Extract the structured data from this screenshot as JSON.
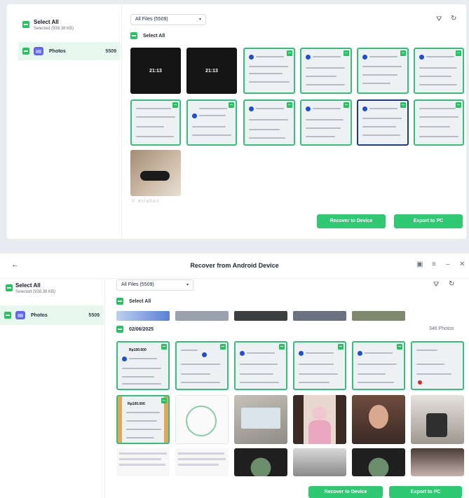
{
  "panel1": {
    "sidebar": {
      "select_all": "Select All",
      "selected_info": "Selected (938.38 KB)",
      "photos_label": "Photos",
      "photos_count": "5509"
    },
    "filter": {
      "selected": "All Files (5509)"
    },
    "select_all": "Select All",
    "lock_screens": [
      {
        "time": "21:13"
      },
      {
        "time": "21:13"
      }
    ],
    "blurred_caption": "Il aslabas",
    "buttons": {
      "recover": "Recover to Device",
      "export": "Export to PC"
    }
  },
  "panel2": {
    "title": "Recover from Android Device",
    "sidebar": {
      "select_all": "Select All",
      "selected_info": "Selected (938.38 KB)",
      "photos_label": "Photos",
      "photos_count": "5509"
    },
    "filter": {
      "selected": "All Files (5509)"
    },
    "select_all": "Select All",
    "date_group": {
      "date": "02/06/2025",
      "count": "346 Photos"
    },
    "receipt_amounts": [
      "Rp100.000",
      "Rp100.000"
    ],
    "buttons": {
      "recover": "Recover to Device",
      "export": "Export to PC"
    }
  },
  "icons": [
    "checkbox-icon",
    "photos-icon",
    "filter-icon",
    "refresh-icon",
    "back-icon",
    "feedback-icon",
    "menu-icon",
    "minimize-icon",
    "close-icon"
  ],
  "colors": {
    "accent": "#2ec971",
    "selected_row_bg": "#e8f8ee",
    "photos_icon": "#6366f1"
  }
}
